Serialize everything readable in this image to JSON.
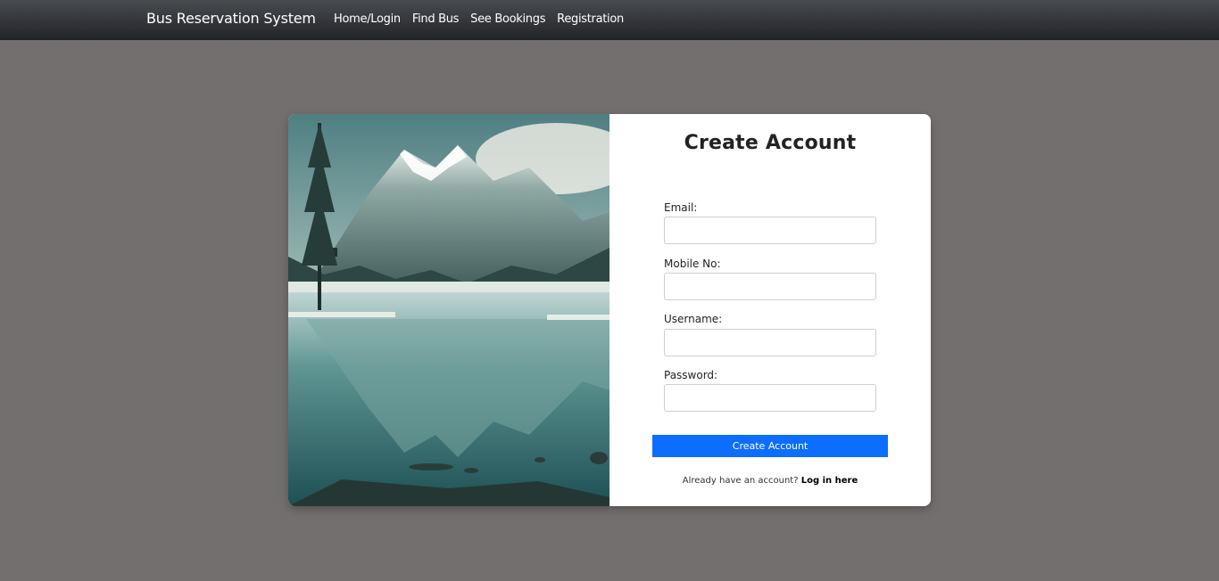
{
  "navbar": {
    "brand": "Bus Reservation System",
    "links": [
      "Home/Login",
      "Find Bus",
      "See Bookings",
      "Registration"
    ]
  },
  "form": {
    "title": "Create Account",
    "fields": [
      {
        "label": "Email:",
        "value": ""
      },
      {
        "label": "Mobile No:",
        "value": ""
      },
      {
        "label": "Username:",
        "value": ""
      },
      {
        "label": "Password:",
        "value": ""
      }
    ],
    "submit_label": "Create Account",
    "login_prompt": "Already have an account?",
    "login_link": "Log in here"
  },
  "colors": {
    "background": "#736f6e",
    "accent": "#0d6efd",
    "navbar": "#2b2d31"
  }
}
